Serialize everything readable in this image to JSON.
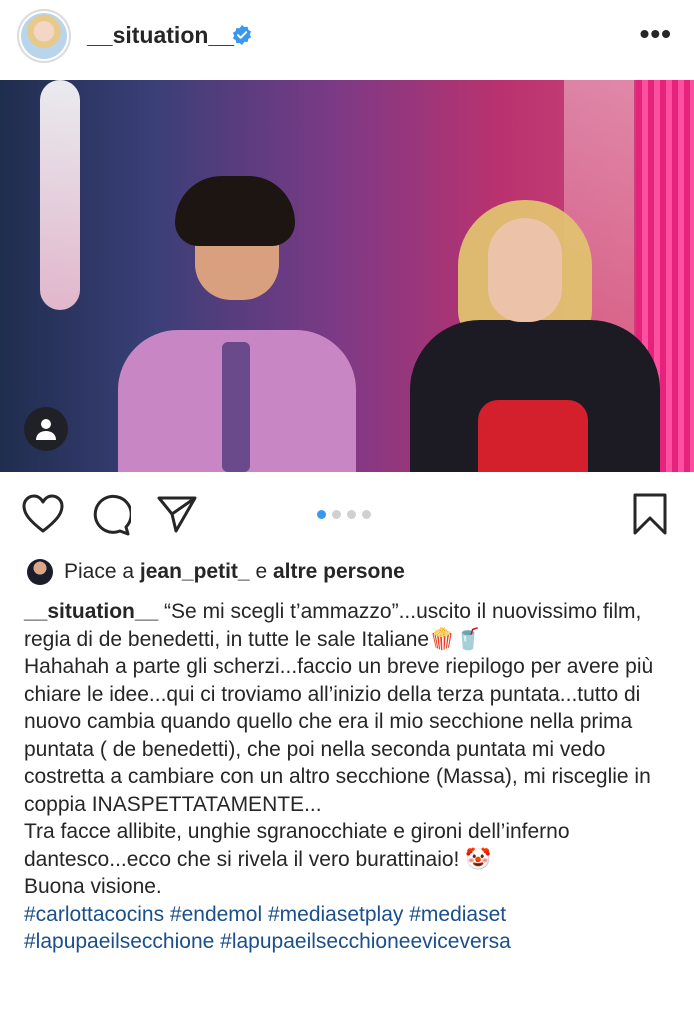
{
  "post": {
    "username": "__situation__",
    "more_icon": "more-horizontal-icon",
    "verified_icon": "verified-badge-icon"
  },
  "actions": {
    "like_icon": "heart-icon",
    "comment_icon": "comment-icon",
    "share_icon": "send-icon",
    "save_icon": "bookmark-icon",
    "carousel_count": 4,
    "carousel_active": 1
  },
  "likes": {
    "prefix": "Piace a ",
    "user": "jean_petit_",
    "middle": " e ",
    "suffix": "altre persone"
  },
  "caption": {
    "username": "__situation__",
    "line1": " “Se mi scegli t’ammazzo”...uscito il nuovissimo film, regia di de benedetti, in tutte le sale Italiane🍿🥤",
    "line2": "Hahahah a parte gli scherzi...faccio un breve riepilogo per avere più chiare le idee...qui ci troviamo all’inizio della terza puntata...tutto di nuovo cambia quando quello che era il mio secchione nella prima puntata ( de benedetti), che poi nella seconda puntata mi vedo costretta a cambiare con un altro secchione (Massa), mi risceglie in coppia INASPETTATAMENTE...",
    "line3": "Tra facce allibite, unghie sgranocchiate e gironi dell’inferno dantesco...ecco che si rivela il vero burattinaio! 🤡",
    "line4": "Buona visione.",
    "hashtags": "#carlottacocins #endemol #mediasetplay #mediaset #lapupaeilsecchione #lapupaeilsecchioneeviceversa"
  },
  "colors": {
    "text": "#262626",
    "hashtag": "#1a4f8b",
    "verified": "#3897f0",
    "carousel_active": "#3897f0"
  }
}
